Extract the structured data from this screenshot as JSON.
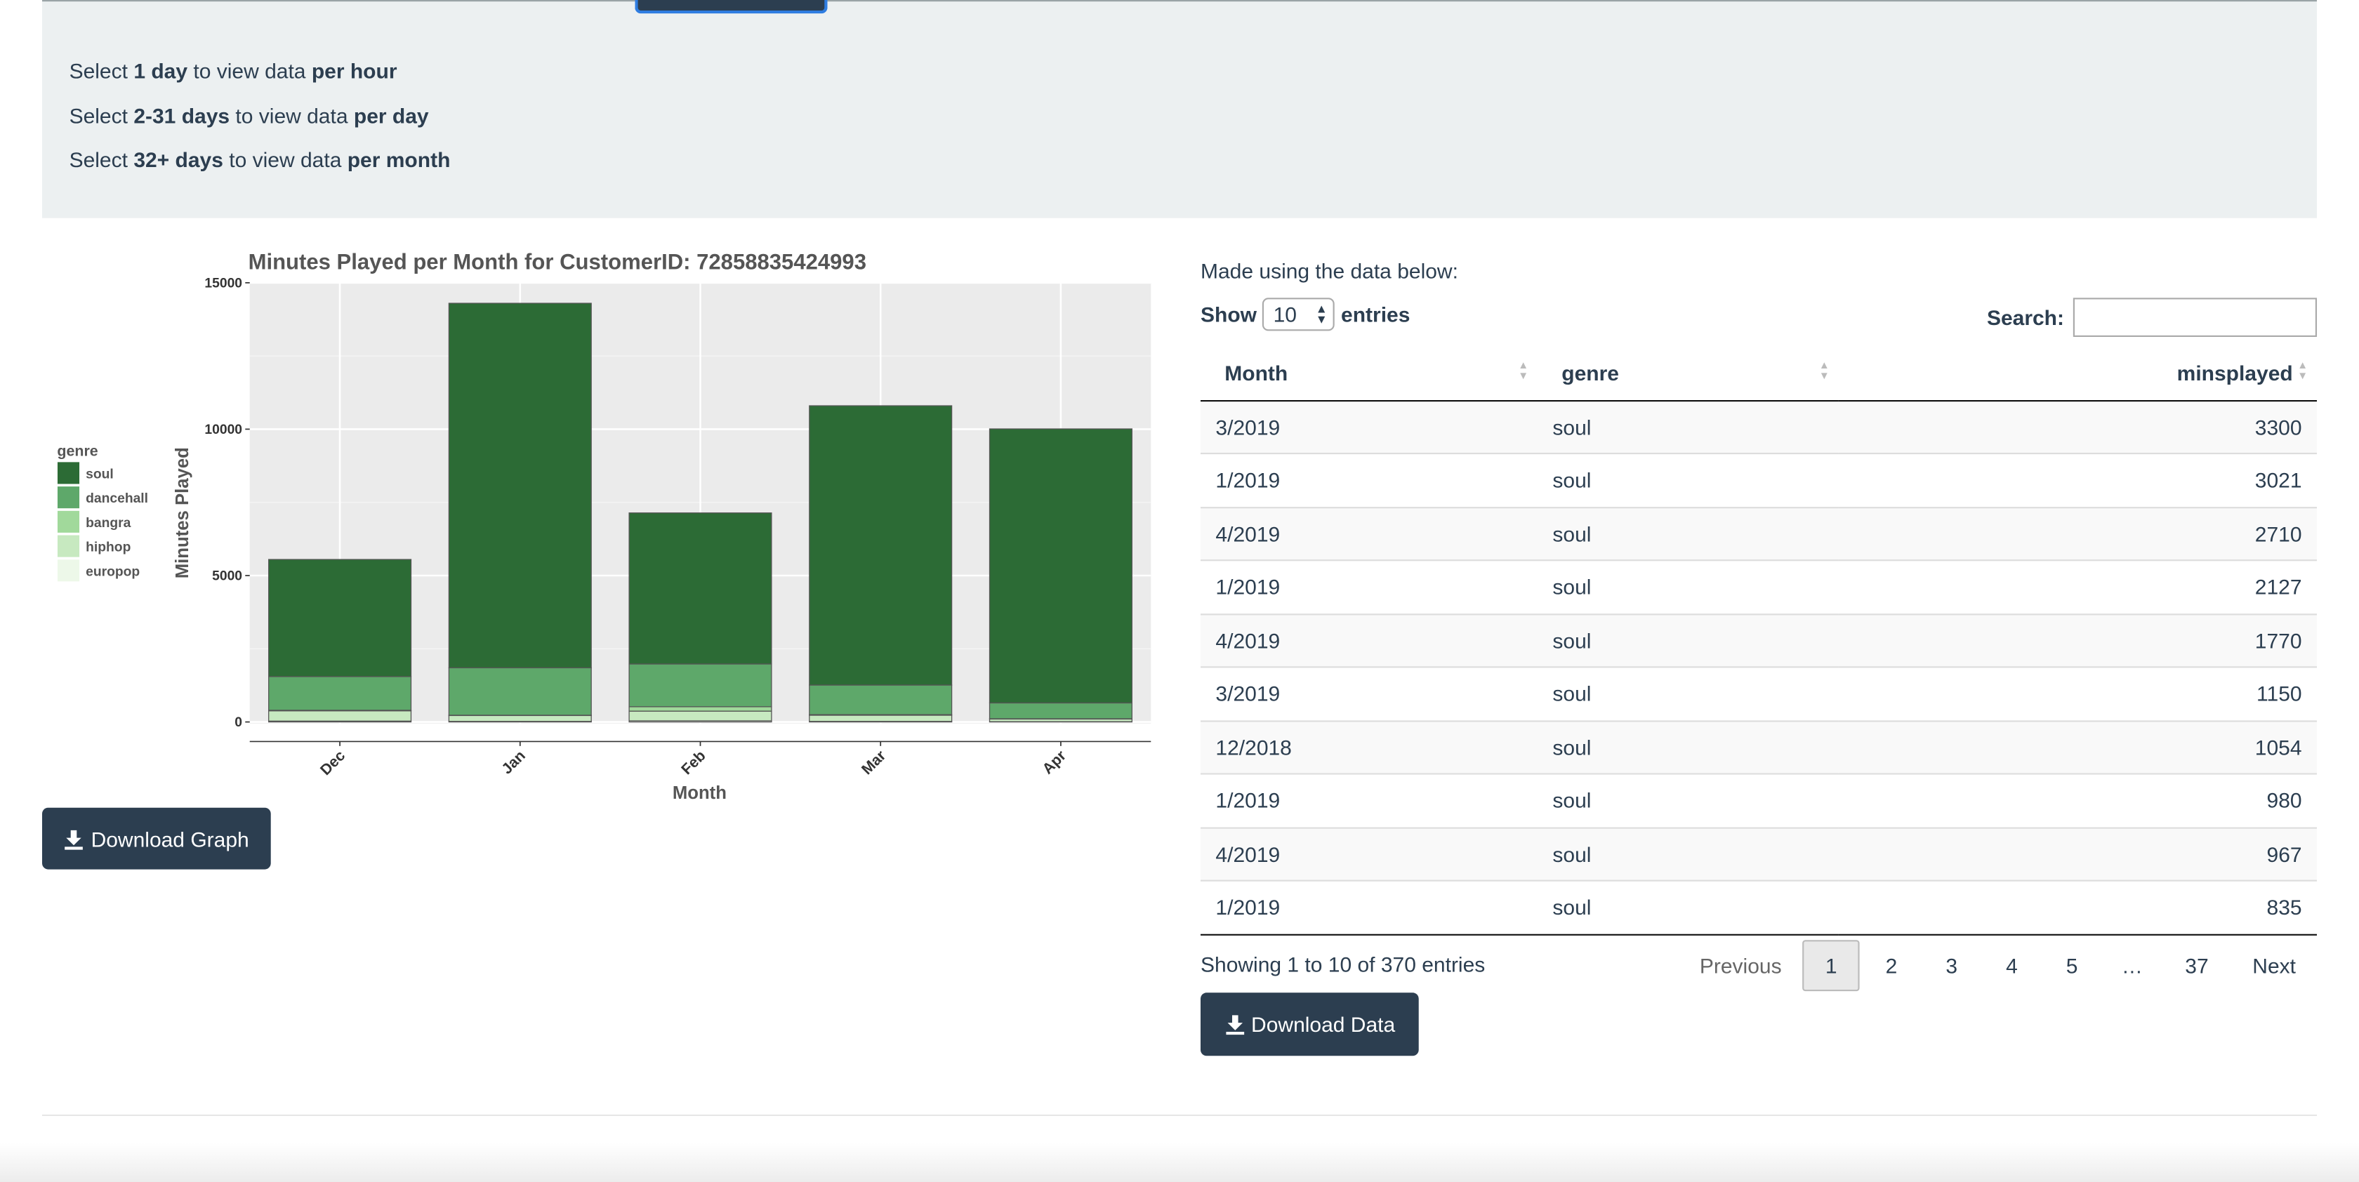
{
  "instructions": [
    {
      "pre": "Select ",
      "b1": "1 day",
      "mid": " to view data ",
      "b2": "per hour"
    },
    {
      "pre": "Select ",
      "b1": "2-31 days",
      "mid": " to view data ",
      "b2": "per day"
    },
    {
      "pre": "Select ",
      "b1": "32+ days",
      "mid": " to view data ",
      "b2": "per month"
    }
  ],
  "chart_data": {
    "type": "bar",
    "stacked": true,
    "title": "Minutes Played per Month for CustomerID: 72858835424993",
    "xlabel": "Month",
    "ylabel": "Minutes Played",
    "categories": [
      "Dec",
      "Jan",
      "Feb",
      "Mar",
      "Apr"
    ],
    "ylim": [
      0,
      15000
    ],
    "yticks": [
      0,
      5000,
      10000,
      15000
    ],
    "grid": true,
    "legend_title": "genre",
    "legend_position": "left",
    "series": [
      {
        "name": "europop",
        "color": "#edf8e9",
        "values": [
          30,
          20,
          40,
          20,
          10
        ]
      },
      {
        "name": "hiphop",
        "color": "#c7e9c0",
        "values": [
          350,
          200,
          330,
          210,
          90
        ]
      },
      {
        "name": "bangra",
        "color": "#a1d99b",
        "values": [
          20,
          10,
          150,
          20,
          10
        ]
      },
      {
        "name": "dancehall",
        "color": "#5ea86a",
        "values": [
          1150,
          1620,
          1460,
          1010,
          540
        ]
      },
      {
        "name": "soul",
        "color": "#2c6b35",
        "values": [
          4000,
          12450,
          5160,
          9540,
          9360
        ]
      }
    ]
  },
  "buttons": {
    "download_graph": "Download Graph",
    "download_data": "Download Data"
  },
  "table": {
    "caption": "Made using the data below:",
    "show_label": "Show",
    "entries_value": "10",
    "entries_label": "entries",
    "search_label": "Search:",
    "columns": [
      "Month",
      "genre",
      "minsplayed"
    ],
    "rows": [
      [
        "3/2019",
        "soul",
        "3300"
      ],
      [
        "1/2019",
        "soul",
        "3021"
      ],
      [
        "4/2019",
        "soul",
        "2710"
      ],
      [
        "1/2019",
        "soul",
        "2127"
      ],
      [
        "4/2019",
        "soul",
        "1770"
      ],
      [
        "3/2019",
        "soul",
        "1150"
      ],
      [
        "12/2018",
        "soul",
        "1054"
      ],
      [
        "1/2019",
        "soul",
        "980"
      ],
      [
        "4/2019",
        "soul",
        "967"
      ],
      [
        "1/2019",
        "soul",
        "835"
      ]
    ],
    "info": "Showing 1 to 10 of 370 entries",
    "pager": {
      "previous": "Previous",
      "pages": [
        "1",
        "2",
        "3",
        "4",
        "5",
        "…",
        "37"
      ],
      "next": "Next"
    }
  }
}
